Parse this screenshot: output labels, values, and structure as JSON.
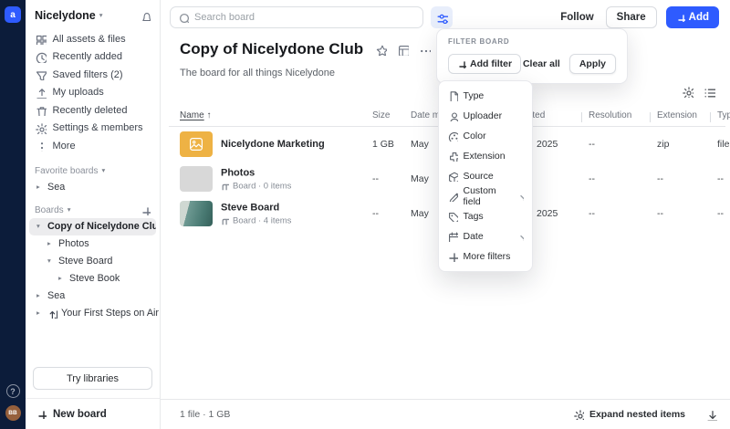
{
  "rail": {
    "avatar_initials": "BB"
  },
  "sidebar": {
    "workspace_name": "Nicelydone",
    "nav": [
      {
        "icon": "grid-icon",
        "label": "All assets & files"
      },
      {
        "icon": "clock-icon",
        "label": "Recently added"
      },
      {
        "icon": "funnel-icon",
        "label": "Saved filters (2)"
      },
      {
        "icon": "upload-icon",
        "label": "My uploads"
      },
      {
        "icon": "trash-icon",
        "label": "Recently deleted"
      },
      {
        "icon": "gear-icon",
        "label": "Settings & members"
      },
      {
        "icon": "dots-icon",
        "label": "More"
      }
    ],
    "favorites_section": "Favorite boards",
    "favorites": [
      {
        "label": "Sea"
      }
    ],
    "boards_section": "Boards",
    "boards": [
      {
        "label": "Copy of Nicelydone Club",
        "selected": true
      },
      {
        "label": "Photos"
      },
      {
        "label": "Steve Board"
      },
      {
        "label": "Steve Book"
      },
      {
        "label": "Sea"
      },
      {
        "label": "Your First Steps on Air"
      }
    ],
    "try_libraries_label": "Try libraries",
    "new_board_label": "New board"
  },
  "topbar": {
    "search_placeholder": "Search board",
    "follow_label": "Follow",
    "share_label": "Share",
    "add_label": "Add"
  },
  "board_header": {
    "title": "Copy of Nicelydone Club",
    "description": "The board for all things Nicelydone"
  },
  "filter_panel": {
    "title": "FILTER BOARD",
    "add_filter_label": "Add filter",
    "clear_all_label": "Clear all",
    "apply_label": "Apply"
  },
  "filter_menu": {
    "items": [
      {
        "icon": "file-icon",
        "label": "Type",
        "has_submenu": false
      },
      {
        "icon": "person-icon",
        "label": "Uploader",
        "has_submenu": false
      },
      {
        "icon": "color-icon",
        "label": "Color",
        "has_submenu": false
      },
      {
        "icon": "puzzle-icon",
        "label": "Extension",
        "has_submenu": false
      },
      {
        "icon": "cube-icon",
        "label": "Source",
        "has_submenu": false
      },
      {
        "icon": "pencil-icon",
        "label": "Custom field",
        "has_submenu": true
      },
      {
        "icon": "tag-icon",
        "label": "Tags",
        "has_submenu": false
      },
      {
        "icon": "calendar-icon",
        "label": "Date",
        "has_submenu": true
      },
      {
        "icon": "plus-icon",
        "label": "More filters",
        "has_submenu": false
      }
    ]
  },
  "table": {
    "columns": [
      "Name",
      "Size",
      "Date modified",
      "Date created",
      "Resolution",
      "Extension",
      "Type"
    ],
    "sort_arrow": "↑",
    "rows": [
      {
        "name": "Nicelydone Marketing",
        "subtitle": "",
        "size": "1 GB",
        "date_modified": "May",
        "date_created": "2025",
        "resolution": "--",
        "extension": "zip",
        "type": "file"
      },
      {
        "name": "Photos",
        "subtitle": "Board · 0 items",
        "size": "--",
        "date_modified": "May",
        "date_created": "",
        "resolution": "--",
        "extension": "--",
        "type": "--"
      },
      {
        "name": "Steve Board",
        "subtitle": "Board · 4 items",
        "size": "--",
        "date_modified": "May",
        "date_created": "2025",
        "resolution": "--",
        "extension": "--",
        "type": "--"
      }
    ]
  },
  "footer": {
    "summary": "1 file · 1 GB",
    "expand_nested_label": "Expand nested items"
  }
}
